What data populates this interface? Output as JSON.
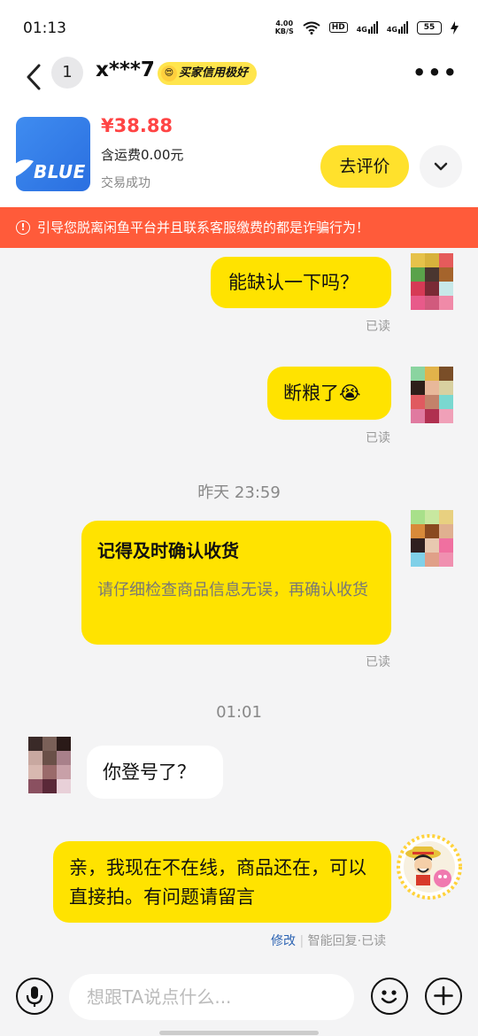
{
  "status_bar": {
    "time": "01:13",
    "speed_top": "4.00",
    "speed_unit": "KB/S",
    "hd": "HD",
    "net1": "4G",
    "net2": "4G",
    "battery": "55"
  },
  "header": {
    "unread_count": "1",
    "name": "x***7",
    "credit_badge": "买家信用极好"
  },
  "product": {
    "price": "¥38.88",
    "shipping": "含运费0.00元",
    "status": "交易成功",
    "review_button": "去评价",
    "thumb_brand": "BLUE"
  },
  "warning": {
    "icon": "!",
    "text": "引导您脱离闲鱼平台并且联系客服缴费的都是诈骗行为！"
  },
  "messages": [
    {
      "text": "能缺认一下吗？",
      "read": "已读"
    },
    {
      "text": "断粮了😭",
      "read": "已读"
    },
    {
      "timestamp": "昨天 23:59"
    },
    {
      "title": "记得及时确认收货",
      "sub": "请仔细检查商品信息无误，再确认收货",
      "read": "已读"
    },
    {
      "timestamp": "01:01"
    },
    {
      "text": "你登号了？"
    },
    {
      "text": "亲，我现在不在线，商品还在，可以直接拍。有问题请留言",
      "edit": "修改",
      "meta": "智能回复·已读"
    }
  ],
  "input": {
    "placeholder": "想跟TA说点什么..."
  },
  "colors": {
    "accent_yellow": "#ffe300",
    "warning_red": "#ff5b3a",
    "price_red": "#ff4444"
  }
}
